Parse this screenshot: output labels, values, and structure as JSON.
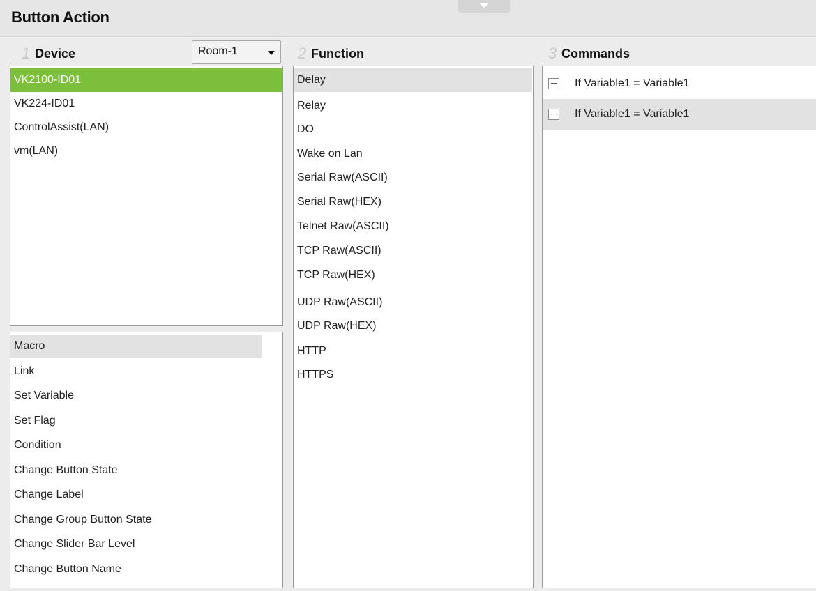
{
  "window": {
    "title": "Button Action"
  },
  "device": {
    "step": "1",
    "label": "Device",
    "room_select": "Room-1",
    "items": [
      "VK2100-ID01",
      "VK224-ID01",
      "ControlAssist(LAN)",
      "vm(LAN)"
    ],
    "selected_index": 0
  },
  "actions": {
    "items": [
      "Macro",
      "Link",
      "Set Variable",
      "Set Flag",
      "Condition",
      "Change Button State",
      "Change Label",
      "Change Group Button State",
      "Change Slider Bar Level",
      "Change Button Name"
    ],
    "highlighted_index": 0
  },
  "function": {
    "step": "2",
    "label": "Function",
    "items": [
      "Delay",
      "Relay",
      "DO",
      "Wake on Lan",
      "Serial Raw(ASCII)",
      "Serial Raw(HEX)",
      "Telnet Raw(ASCII)",
      "TCP Raw(ASCII)",
      "TCP Raw(HEX)",
      "UDP Raw(ASCII)",
      "UDP Raw(HEX)",
      "HTTP",
      "HTTPS"
    ],
    "selected_index": 0
  },
  "commands": {
    "step": "3",
    "label": "Commands",
    "items": [
      "If Variable1 = Variable1",
      "If Variable1 = Variable1"
    ],
    "selected_index": 1
  },
  "colors": {
    "selection_green": "#7cbf3c",
    "selection_grey": "#e2e2e2"
  }
}
